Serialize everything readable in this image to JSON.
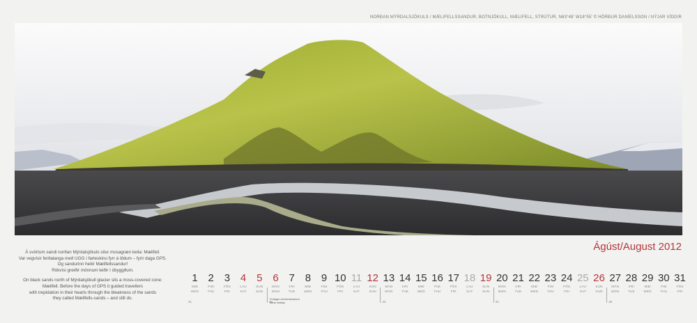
{
  "credit": "NORÐAN MÝRDALSJÖKULS / MÆLIFELLSSANDUR, BOTNJÖKULL, MÆLIFELL, STRÚTUR, N63°48' W18°55' © HÖRÐUR DANÍELSSON / NÝJAR VÍDDIR",
  "caption_is": [
    "Á svörtum sandi norðan Mýrdalsjökuls situr mosagræn keila: Mælifell.",
    "Var vegvísir ferðalanga með UGG í farteskinu fyrr á öldum – fyrir daga GPS.",
    "Og sandurinn heitir Mælifellssandur!",
    "Rökvísi greiðir mönnum leiðir í óbyggðum."
  ],
  "caption_en": [
    "On black sands north of Mýrdalsjökull glacier sits a moss-covered cone:",
    "Mælifell. Before the days of GPS it guided travellers",
    "with trepidation in their hearts through the bleakness of the sands",
    "they called Mælifells-sands – and still do."
  ],
  "month_label": "Ágúst/August 2012",
  "days": [
    {
      "n": "1",
      "is": "MIÐ",
      "en": "WED",
      "s": "n"
    },
    {
      "n": "2",
      "is": "FIM",
      "en": "THU",
      "s": "n"
    },
    {
      "n": "3",
      "is": "FÖS",
      "en": "FRI",
      "s": "n"
    },
    {
      "n": "4",
      "is": "LAU",
      "en": "SAT",
      "s": "r"
    },
    {
      "n": "5",
      "is": "SUN",
      "en": "SUN",
      "s": "r"
    },
    {
      "n": "6",
      "is": "MÁN",
      "en": "MON",
      "s": "r"
    },
    {
      "n": "7",
      "is": "ÞRI",
      "en": "TUE",
      "s": "n"
    },
    {
      "n": "8",
      "is": "MIÐ",
      "en": "WED",
      "s": "n"
    },
    {
      "n": "9",
      "is": "FIM",
      "en": "THU",
      "s": "n"
    },
    {
      "n": "10",
      "is": "FÖS",
      "en": "FRI",
      "s": "n"
    },
    {
      "n": "11",
      "is": "LAU",
      "en": "SAT",
      "s": "g"
    },
    {
      "n": "12",
      "is": "SUN",
      "en": "SUN",
      "s": "r"
    },
    {
      "n": "13",
      "is": "MÁN",
      "en": "MON",
      "s": "n"
    },
    {
      "n": "14",
      "is": "ÞRI",
      "en": "TUE",
      "s": "n"
    },
    {
      "n": "15",
      "is": "MIÐ",
      "en": "WED",
      "s": "n"
    },
    {
      "n": "16",
      "is": "FIM",
      "en": "THU",
      "s": "n"
    },
    {
      "n": "17",
      "is": "FÖS",
      "en": "FRI",
      "s": "n"
    },
    {
      "n": "18",
      "is": "LAU",
      "en": "SAT",
      "s": "g"
    },
    {
      "n": "19",
      "is": "SUN",
      "en": "SUN",
      "s": "r"
    },
    {
      "n": "20",
      "is": "MÁN",
      "en": "MON",
      "s": "n"
    },
    {
      "n": "21",
      "is": "ÞRI",
      "en": "TUE",
      "s": "n"
    },
    {
      "n": "22",
      "is": "MIÐ",
      "en": "WED",
      "s": "n"
    },
    {
      "n": "23",
      "is": "FIM",
      "en": "THU",
      "s": "n"
    },
    {
      "n": "24",
      "is": "FÖS",
      "en": "FRI",
      "s": "n"
    },
    {
      "n": "25",
      "is": "LAU",
      "en": "SAT",
      "s": "g"
    },
    {
      "n": "26",
      "is": "SUN",
      "en": "SUN",
      "s": "r"
    },
    {
      "n": "27",
      "is": "MÁN",
      "en": "MON",
      "s": "n"
    },
    {
      "n": "28",
      "is": "ÞRI",
      "en": "TUE",
      "s": "n"
    },
    {
      "n": "29",
      "is": "MIÐ",
      "en": "WED",
      "s": "n"
    },
    {
      "n": "30",
      "is": "FIM",
      "en": "THU",
      "s": "n"
    },
    {
      "n": "31",
      "is": "FÖS",
      "en": "FRI",
      "s": "n"
    }
  ],
  "weeks": [
    "31",
    "32",
    "33",
    "34",
    "35"
  ],
  "holiday": [
    "Frídagur verslunarmanna",
    "Bank holiday"
  ],
  "colors": {
    "accent": "#b3363c",
    "text": "#333333",
    "muted": "#888888",
    "background": "#f2f2f0"
  }
}
